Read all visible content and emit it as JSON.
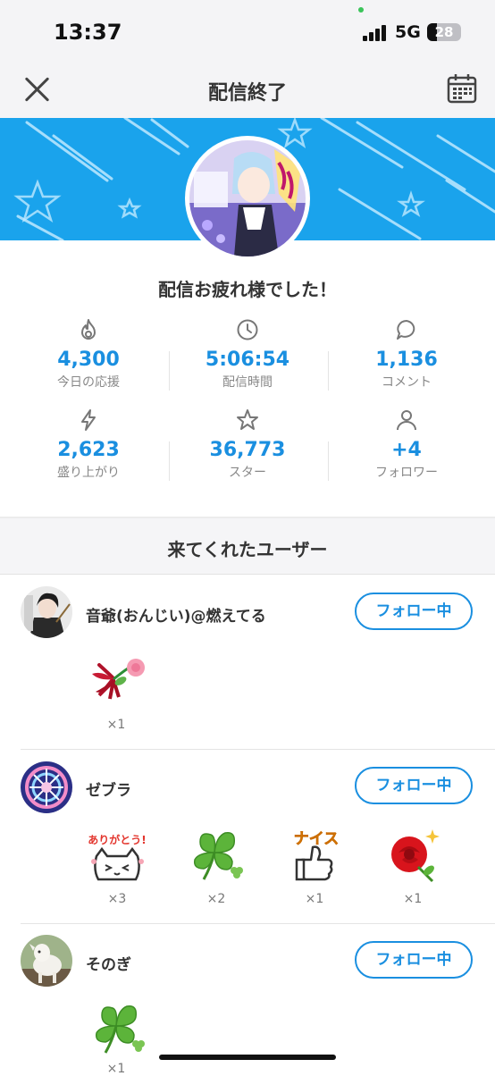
{
  "status": {
    "time": "13:37",
    "network": "5G",
    "battery": "28"
  },
  "header": {
    "title": "配信終了",
    "close_icon": "close-icon",
    "calendar_icon": "calendar-icon"
  },
  "thanks_message": "配信お疲れ様でした！",
  "stats": [
    {
      "value": "4,300",
      "label": "今日の応援",
      "icon": "flame-icon"
    },
    {
      "value": "5:06:54",
      "label": "配信時間",
      "icon": "clock-icon"
    },
    {
      "value": "1,136",
      "label": "コメント",
      "icon": "comment-icon"
    },
    {
      "value": "2,623",
      "label": "盛り上がり",
      "icon": "lightning-icon"
    },
    {
      "value": "36,773",
      "label": "スター",
      "icon": "star-icon"
    },
    {
      "value": "+4",
      "label": "フォロワー",
      "icon": "person-icon"
    }
  ],
  "colors": {
    "accent": "#1a8fe0",
    "banner": "#1aa3ec"
  },
  "users_section": {
    "title": "来てくれたユーザー",
    "follow_label": "フォロー中",
    "users": [
      {
        "name": "音爺(おんじい)@燃えてる",
        "gifts": [
          {
            "icon": "rose-bow-icon",
            "count": "×1"
          }
        ]
      },
      {
        "name": "ゼブラ",
        "gifts": [
          {
            "icon": "arigatou-cat-icon",
            "count": "×3",
            "text": "ありがとう!"
          },
          {
            "icon": "clover-icon",
            "count": "×2"
          },
          {
            "icon": "nice-thumbs-up-icon",
            "count": "×1",
            "text": "ナイス"
          },
          {
            "icon": "red-rose-icon",
            "count": "×1"
          }
        ]
      },
      {
        "name": "そのぎ",
        "gifts": [
          {
            "icon": "clover-icon",
            "count": "×1"
          }
        ]
      }
    ]
  }
}
